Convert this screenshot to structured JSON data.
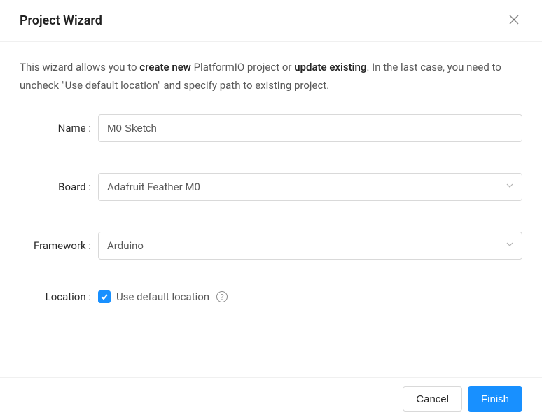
{
  "title": "Project Wizard",
  "intro": {
    "pre": "This wizard allows you to ",
    "b1": "create new",
    "mid": " PlatformIO project or ",
    "b2": "update existing",
    "post": ". In the last case, you need to uncheck \"Use default location\" and specify path to existing project."
  },
  "form": {
    "name_label": "Name :",
    "name_value": "M0 Sketch",
    "board_label": "Board :",
    "board_value": "Adafruit Feather M0",
    "framework_label": "Framework :",
    "framework_value": "Arduino",
    "location_label": "Location :",
    "location_checkbox_label": "Use default location",
    "location_checked": true
  },
  "buttons": {
    "cancel": "Cancel",
    "finish": "Finish"
  }
}
